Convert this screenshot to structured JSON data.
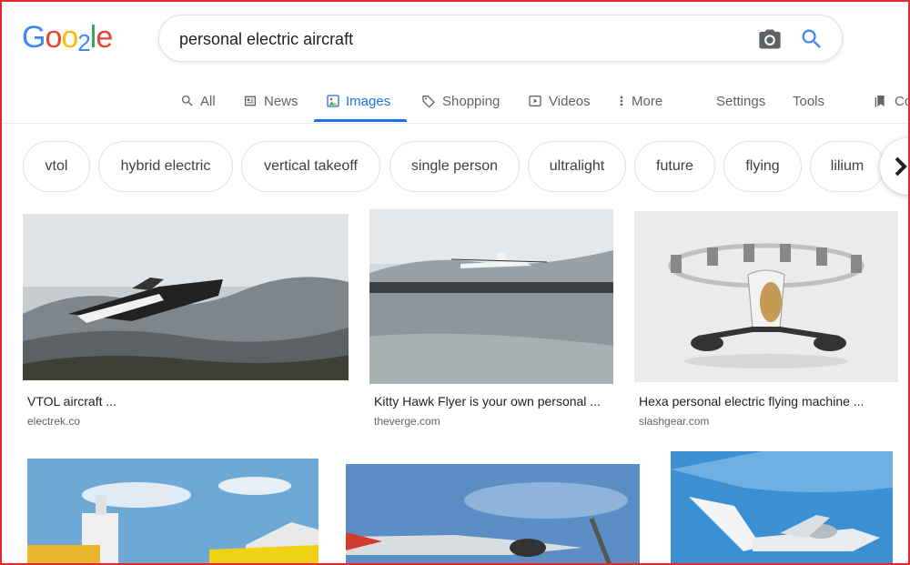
{
  "logo": {
    "letters": [
      "G",
      "o",
      "o",
      "2",
      "l",
      "e"
    ]
  },
  "search": {
    "query": "personal electric aircraft",
    "camera_icon": "camera-icon",
    "search_icon": "search-icon"
  },
  "tabs": [
    {
      "label": "All",
      "icon": "search-icon"
    },
    {
      "label": "News",
      "icon": "news-icon"
    },
    {
      "label": "Images",
      "icon": "image-icon",
      "active": true
    },
    {
      "label": "Shopping",
      "icon": "tag-icon"
    },
    {
      "label": "Videos",
      "icon": "play-icon"
    },
    {
      "label": "More",
      "icon": "more-vert-icon"
    },
    {
      "label": "Settings"
    },
    {
      "label": "Tools"
    },
    {
      "label": "Co",
      "icon": "bookmark-icon"
    }
  ],
  "chips": [
    "vtol",
    "hybrid electric",
    "vertical takeoff",
    "single person",
    "ultralight",
    "future",
    "flying",
    "lilium"
  ],
  "results": [
    {
      "title": "VTOL aircraft ...",
      "source": "electrek.co"
    },
    {
      "title": "Kitty Hawk Flyer is your own personal ...",
      "source": "theverge.com"
    },
    {
      "title": "Hexa personal electric flying machine ...",
      "source": "slashgear.com"
    },
    {
      "title": "",
      "source": ""
    },
    {
      "title": "",
      "source": ""
    },
    {
      "title": "",
      "source": ""
    }
  ],
  "colors": {
    "accent": "#1a73e8",
    "frame": "#e8262a",
    "g_blue": "#4285f4",
    "g_red": "#ea4335",
    "g_yellow": "#fbbc05",
    "g_green": "#34a853"
  }
}
